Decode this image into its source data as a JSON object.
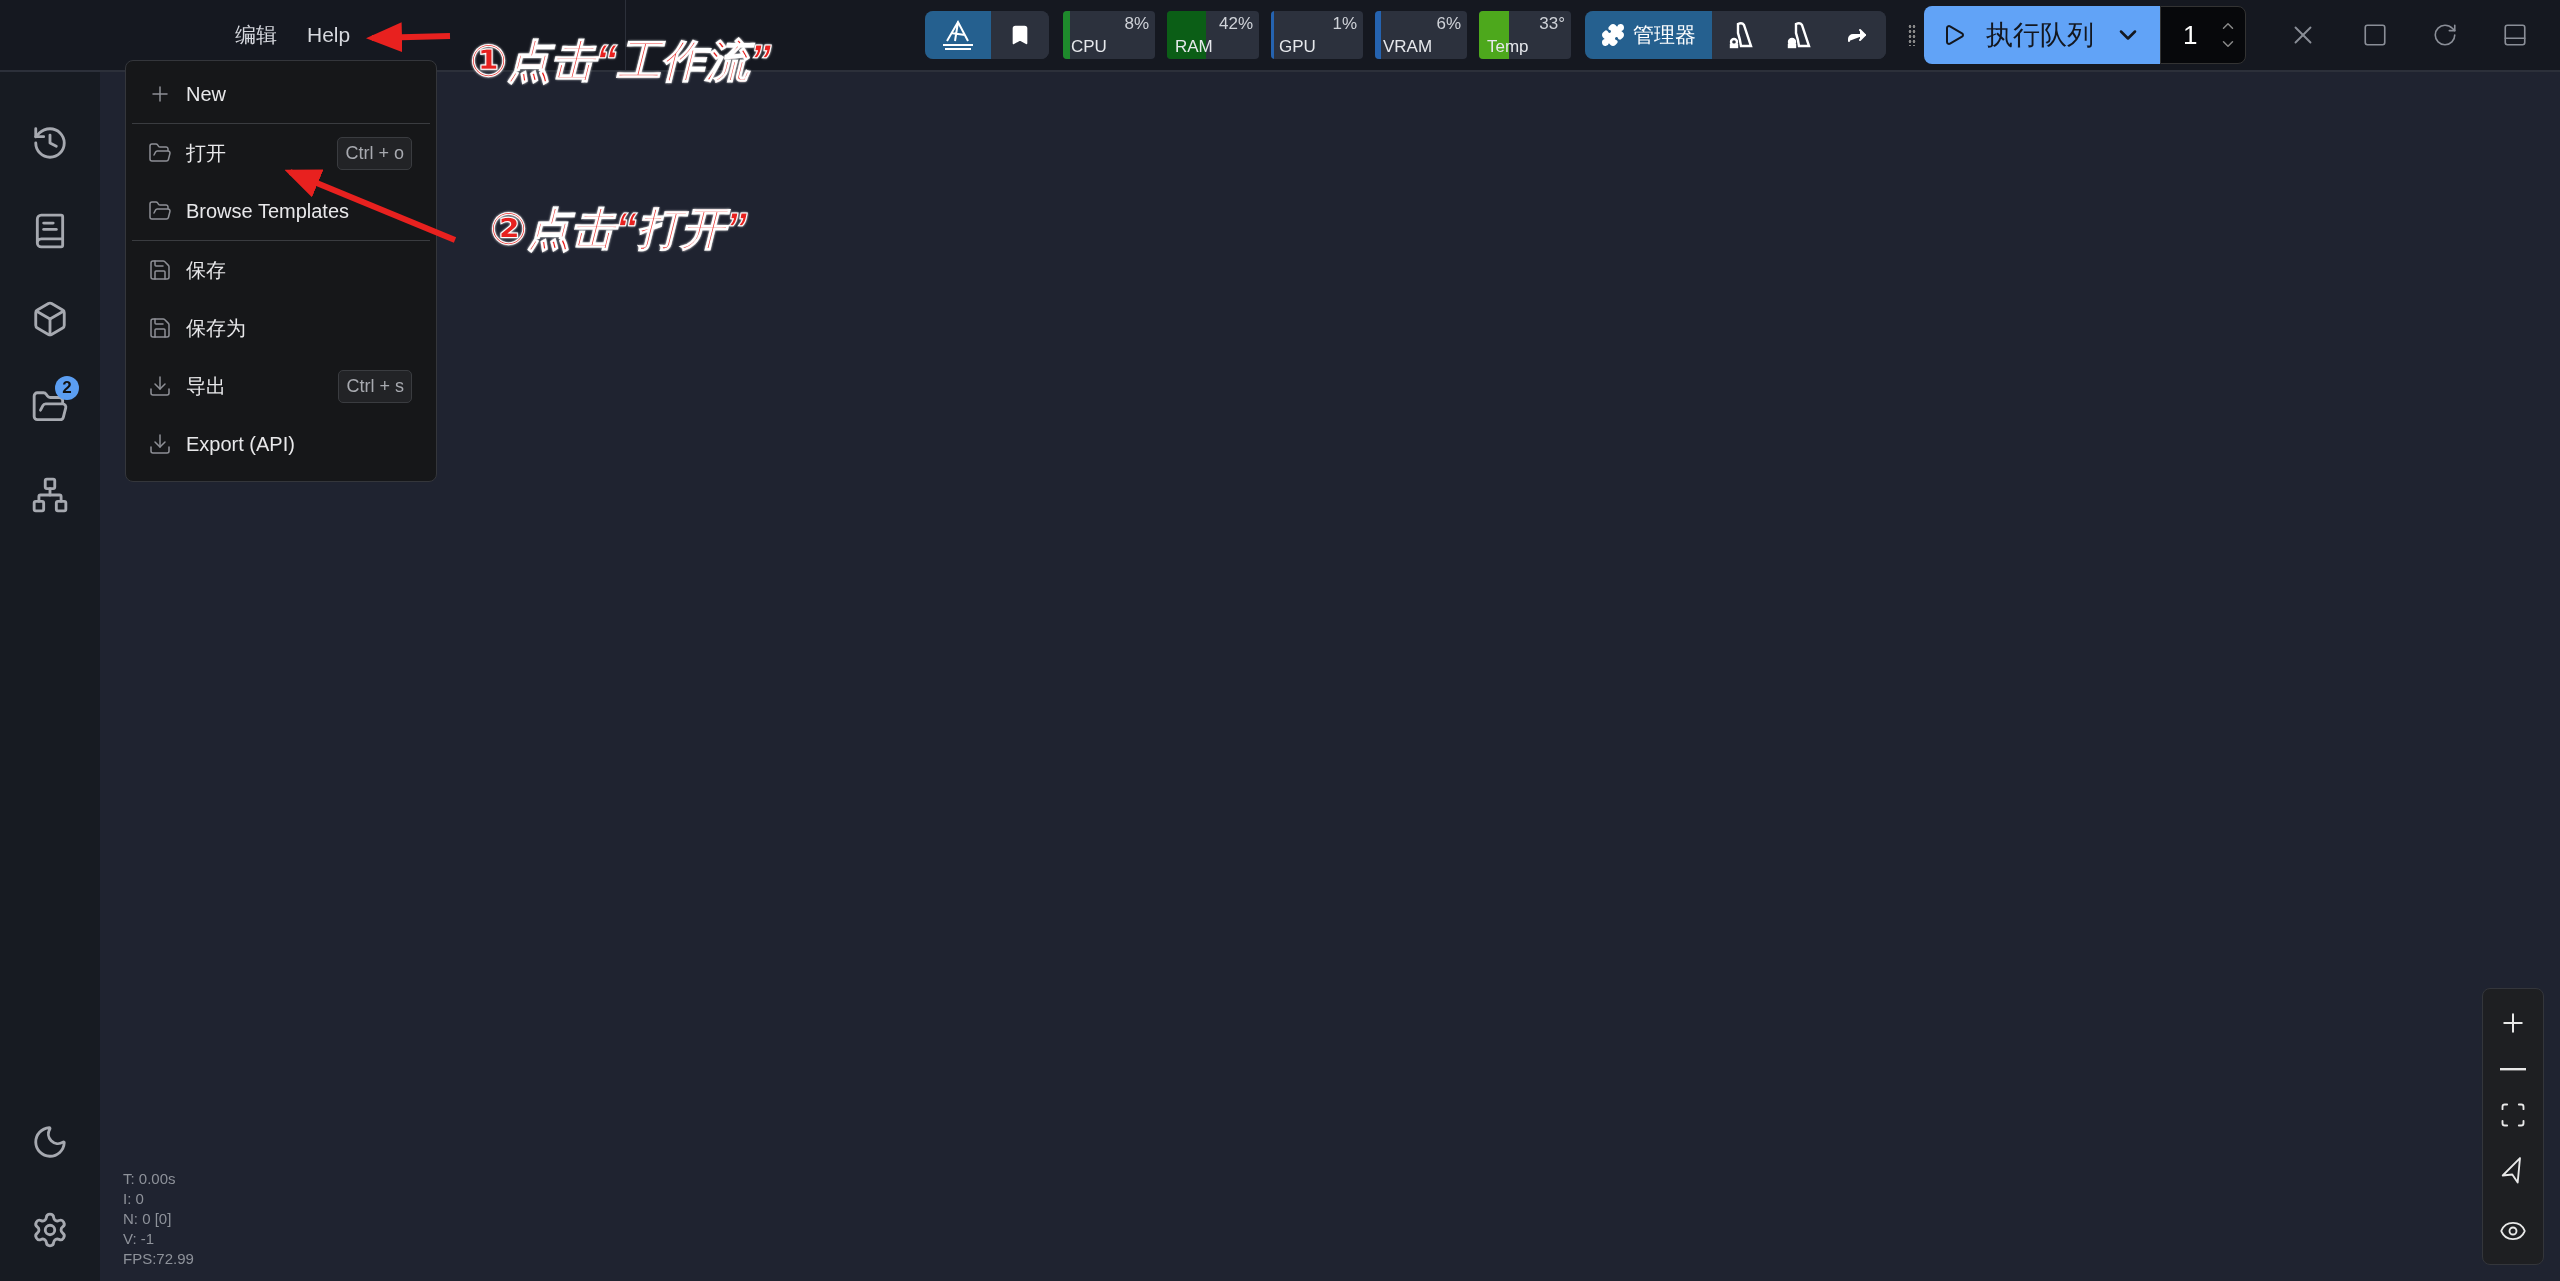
{
  "menubar": {
    "items": [
      {
        "label": "编辑"
      },
      {
        "label": "Help"
      }
    ]
  },
  "menu": {
    "items": [
      {
        "kind": "item",
        "label": "New"
      },
      {
        "kind": "divider"
      },
      {
        "kind": "item",
        "label": "打开",
        "shortcut": "Ctrl + o"
      },
      {
        "kind": "item",
        "label": "Browse Templates"
      },
      {
        "kind": "divider"
      },
      {
        "kind": "item",
        "label": "保存"
      },
      {
        "kind": "item",
        "label": "保存为"
      },
      {
        "kind": "item",
        "label": "导出",
        "shortcut": "Ctrl + s"
      },
      {
        "kind": "item",
        "label": "Export (API)"
      }
    ]
  },
  "monitors": [
    {
      "label": "CPU",
      "reading": "8%",
      "level": 0.08,
      "color": "#1e8a2c"
    },
    {
      "label": "RAM",
      "reading": "42%",
      "level": 0.42,
      "color": "#0b5e16"
    },
    {
      "label": "GPU",
      "reading": "1%",
      "level": 0.01,
      "color": "#2563b0"
    },
    {
      "label": "VRAM",
      "reading": "6%",
      "level": 0.06,
      "color": "#2563b0"
    },
    {
      "label": "Temp",
      "reading": "33°",
      "level": 0.33,
      "color": "#4da81c"
    }
  ],
  "manager_button": {
    "label": "管理器"
  },
  "queue_button": {
    "label": "执行队列"
  },
  "batch_count": {
    "value": "1"
  },
  "sidebar": {
    "items": [
      {
        "badge": "2"
      }
    ]
  },
  "stats": [
    "T: 0.00s",
    "I: 0",
    "N: 0 [0]",
    "V: -1",
    "FPS:72.99"
  ],
  "annotations": [
    {
      "text": "①点击“工作流”"
    },
    {
      "text": "②点击“打开”"
    }
  ]
}
